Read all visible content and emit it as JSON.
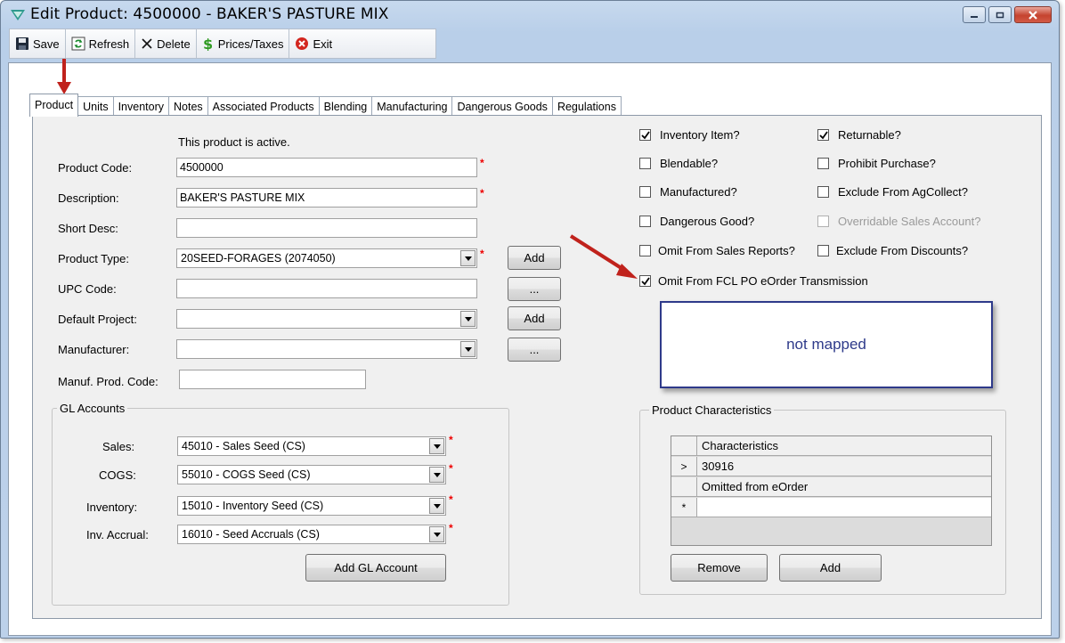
{
  "window": {
    "title": "Edit Product: 4500000 - BAKER'S PASTURE MIX"
  },
  "toolbar": {
    "save": "Save",
    "refresh": "Refresh",
    "delete": "Delete",
    "prices_taxes": "Prices/Taxes",
    "exit": "Exit"
  },
  "tabs": [
    "Product",
    "Units",
    "Inventory",
    "Notes",
    "Associated Products",
    "Blending",
    "Manufacturing",
    "Dangerous Goods",
    "Regulations"
  ],
  "product": {
    "status_text": "This product is active.",
    "labels": {
      "product_code": "Product Code:",
      "description": "Description:",
      "short_desc": "Short Desc:",
      "product_type": "Product Type:",
      "upc_code": "UPC Code:",
      "default_project": "Default Project:",
      "manufacturer": "Manufacturer:",
      "manuf_prod_code": "Manuf. Prod. Code:"
    },
    "values": {
      "product_code": "4500000",
      "description": "BAKER'S PASTURE MIX",
      "short_desc": "",
      "product_type": "20SEED-FORAGES (2074050)",
      "upc_code": "",
      "default_project": "",
      "manufacturer": "",
      "manuf_prod_code": ""
    },
    "buttons": {
      "add_type": "Add",
      "upc_more": "...",
      "add_project": "Add",
      "manufacturer_more": "..."
    },
    "required_mark": "*"
  },
  "gl": {
    "title": "GL Accounts",
    "sales_label": "Sales:",
    "sales_value": "45010 - Sales Seed (CS)",
    "cogs_label": "COGS:",
    "cogs_value": "55010 - COGS Seed (CS)",
    "inventory_label": "Inventory:",
    "inventory_value": "15010 - Inventory Seed (CS)",
    "accrual_label": "Inv. Accrual:",
    "accrual_value": "16010 - Seed Accruals (CS)",
    "add_button": "Add GL Account"
  },
  "checkboxes": {
    "inventory_item": {
      "label": "Inventory Item?",
      "checked": true
    },
    "returnable": {
      "label": "Returnable?",
      "checked": true
    },
    "blendable": {
      "label": "Blendable?",
      "checked": false
    },
    "prohibit_purchase": {
      "label": "Prohibit Purchase?",
      "checked": false
    },
    "manufactured": {
      "label": "Manufactured?",
      "checked": false
    },
    "exclude_agcollect": {
      "label": "Exclude From AgCollect?",
      "checked": false
    },
    "dangerous_good": {
      "label": "Dangerous Good?",
      "checked": false
    },
    "overridable_sales": {
      "label": "Overridable Sales Account?",
      "checked": false
    },
    "omit_sales_reports": {
      "label": "Omit From Sales Reports?",
      "checked": false
    },
    "exclude_discounts": {
      "label": "Exclude From Discounts?",
      "checked": false
    },
    "omit_fcl": {
      "label": "Omit From FCL PO eOrder Transmission",
      "checked": true
    }
  },
  "annotation": {
    "text": "not mapped"
  },
  "characteristics": {
    "title": "Product Characteristics",
    "header": "Characteristics",
    "rows": [
      "30916",
      "Omitted from eOrder",
      ""
    ],
    "row_indicator": ">",
    "new_row_indicator": "*",
    "remove_button": "Remove",
    "add_button": "Add"
  },
  "colors": {
    "arrow": "#c0221c",
    "required": "#e00000",
    "annotation": "#2e3a8a"
  }
}
